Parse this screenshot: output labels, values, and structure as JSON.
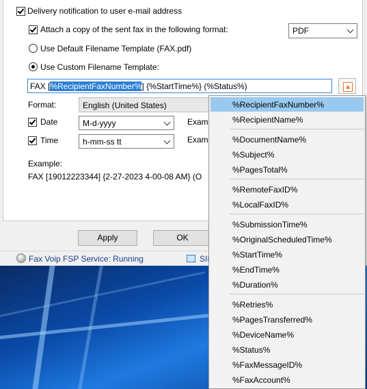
{
  "delivery": {
    "notify_label": "Delivery notification to user e-mail address",
    "attach_label": "Attach a copy of the sent fax in the following format:",
    "attach_format": "PDF",
    "default_template_label": "Use Default Filename Template (FAX.pdf)",
    "custom_template_label": "Use Custom Filename Template:",
    "template_prefix": "FAX [",
    "template_selected": "%RecipientFaxNumber%",
    "template_suffix": "] {%StartTime%} (%Status%)",
    "insert_icon_glyph": "a"
  },
  "format": {
    "label": "Format:",
    "value": "English (United States)"
  },
  "date": {
    "label": "Date",
    "value": "M-d-yyyy",
    "example_label": "Exam"
  },
  "time": {
    "label": "Time",
    "value": "h-mm-ss tt",
    "example_label": "Exam"
  },
  "example": {
    "label": "Example:",
    "value": "FAX [19012223344] {2-27-2023 4-00-08 AM} (O"
  },
  "buttons": {
    "apply": "Apply",
    "ok": "OK"
  },
  "statusbar": {
    "service": "Fax Voip FSP Service: Running",
    "second": "SII"
  },
  "menu": {
    "items": [
      "%RecipientFaxNumber%",
      "%RecipientName%",
      "%DocumentName%",
      "%Subject%",
      "%PagesTotal%",
      "%RemoteFaxID%",
      "%LocalFaxID%",
      "%SubmissionTime%",
      "%OriginalScheduledTime%",
      "%StartTime%",
      "%EndTime%",
      "%Duration%",
      "%Retries%",
      "%PagesTransferred%",
      "%DeviceName%",
      "%Status%",
      "%FaxMessageID%",
      "%FaxAccount%"
    ]
  },
  "colors": {
    "selection": "#2a7fd4",
    "menu_highlight": "#99c9ef",
    "status_text": "#1a3e8a"
  }
}
